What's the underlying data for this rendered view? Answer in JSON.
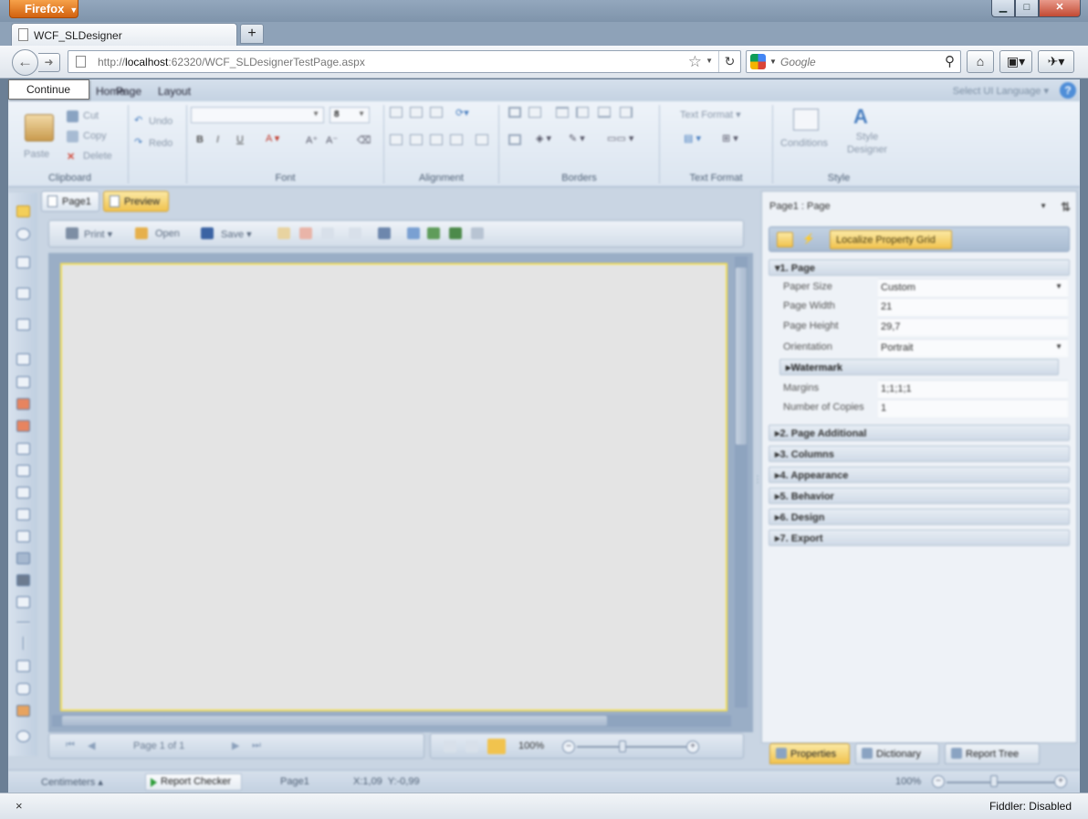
{
  "browser": {
    "menu_button": "Firefox",
    "tab_title": "WCF_SLDesigner",
    "new_tab": "+",
    "url_prefix": "http://",
    "url_host": "localhost",
    "url_rest": ":62320/WCF_SLDesignerTestPage.aspx",
    "search_placeholder": "Google",
    "status_close": "×",
    "status_fiddler": "Fiddler: Disabled"
  },
  "tooltip": {
    "continue": "Continue"
  },
  "ribbon": {
    "tabs": [
      "Home",
      "Page",
      "Layout"
    ],
    "select_language": "Select UI Language",
    "groups": {
      "clipboard": {
        "label": "Clipboard",
        "paste": "Paste",
        "cut": "Cut",
        "copy": "Copy",
        "delete": "Delete"
      },
      "undo": {
        "undo": "Undo",
        "redo": "Redo"
      },
      "font": {
        "label": "Font",
        "size": "8"
      },
      "alignment": {
        "label": "Alignment"
      },
      "borders": {
        "label": "Borders"
      },
      "text_format": {
        "label": "Text Format",
        "combo": "Text Format"
      },
      "style": {
        "label": "Style",
        "conditions": "Conditions",
        "style_designer": "Style Designer"
      }
    }
  },
  "page_tabs": {
    "page1": "Page1",
    "preview": "Preview"
  },
  "preview_toolbar": {
    "print": "Print",
    "open": "Open",
    "save": "Save"
  },
  "pager": {
    "page_info": "Page 1 of 1",
    "zoom": "100%"
  },
  "property_grid": {
    "object": "Page1 : Page",
    "localize": "Localize Property Grid",
    "category_page": "1. Page",
    "rows": [
      {
        "key": "Paper Size",
        "value": "Custom",
        "dropdown": true
      },
      {
        "key": "Page Width",
        "value": "21",
        "dropdown": false
      },
      {
        "key": "Page Height",
        "value": "29,7",
        "dropdown": false
      },
      {
        "key": "Orientation",
        "value": "Portrait",
        "dropdown": true
      }
    ],
    "watermark": "Watermark",
    "rows2": [
      {
        "key": "Margins",
        "value": "1;1;1;1"
      },
      {
        "key": "Number of Copies",
        "value": "1"
      }
    ],
    "categories": [
      "2. Page Additional",
      "3. Columns",
      "4. Appearance",
      "5. Behavior",
      "6. Design",
      "7. Export"
    ],
    "bottom_tabs": [
      "Properties",
      "Dictionary",
      "Report Tree"
    ]
  },
  "statusbar": {
    "units": "Centimeters",
    "report_checker": "Report Checker",
    "page": "Page1",
    "coords": "X:1,09  Y:-0,99",
    "zoom": "100%"
  }
}
